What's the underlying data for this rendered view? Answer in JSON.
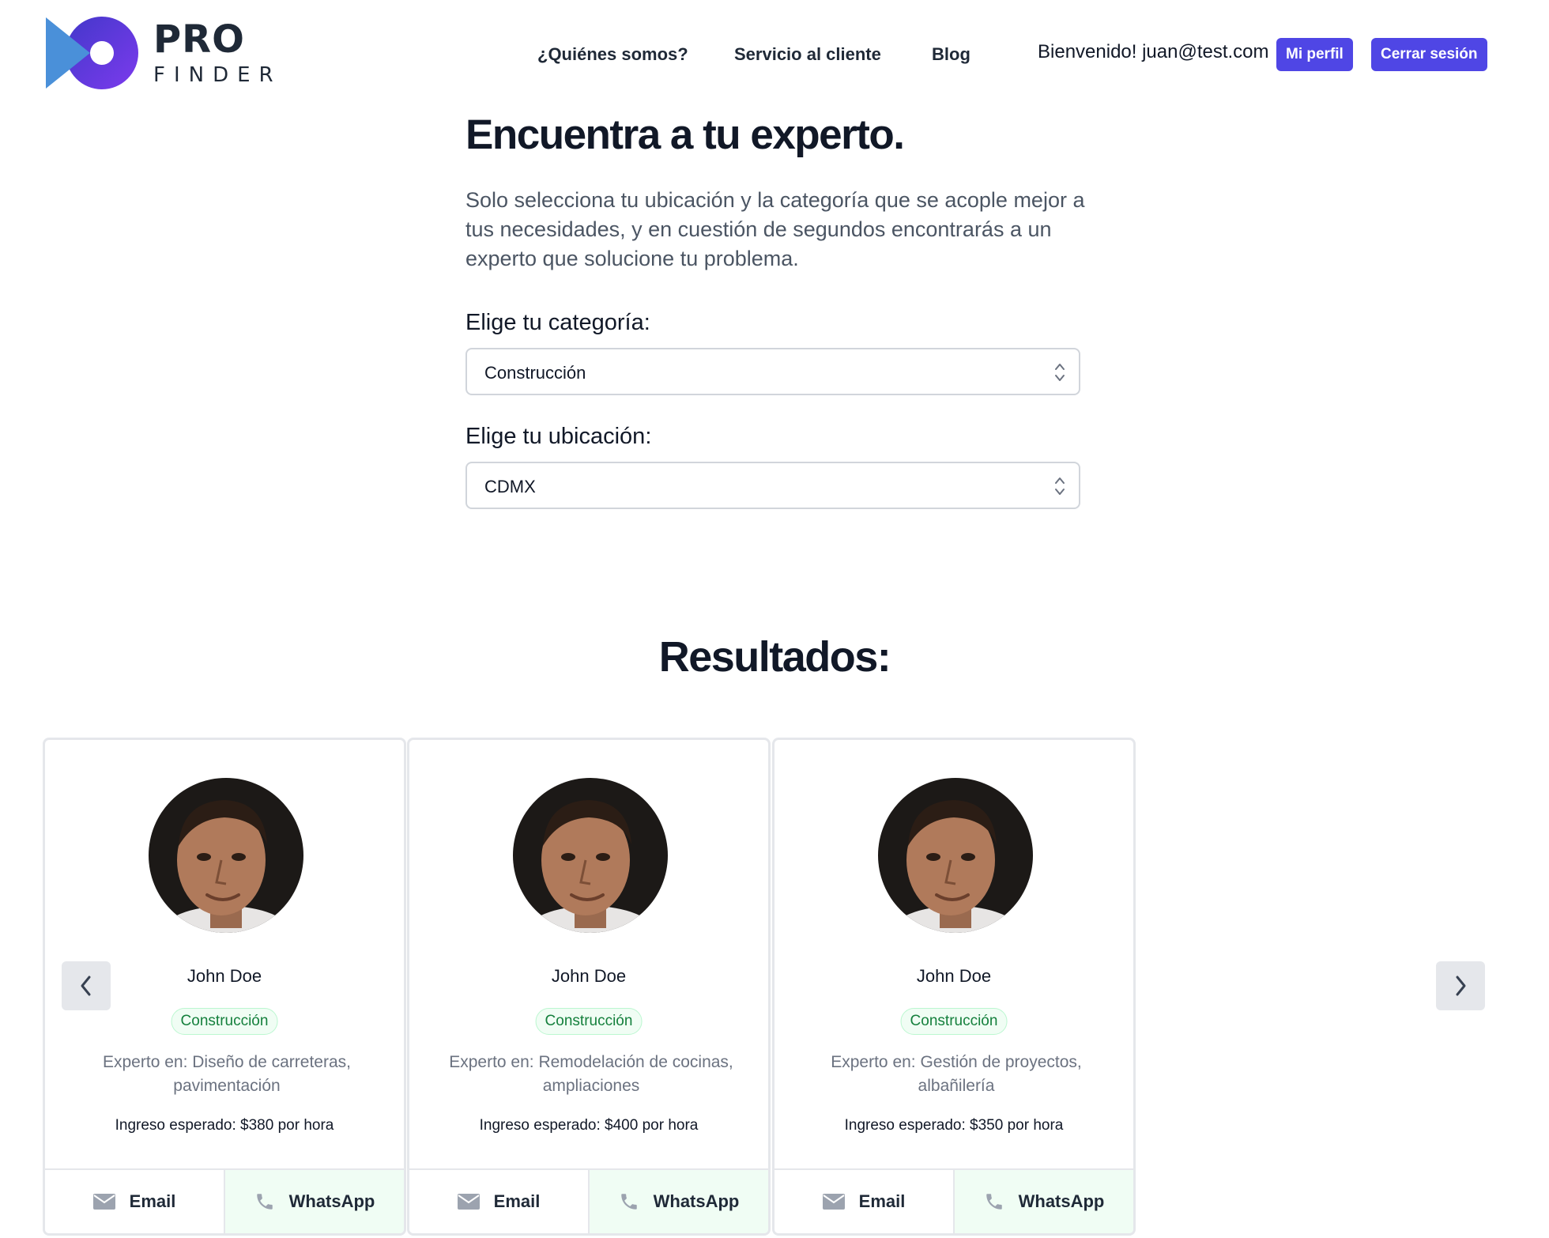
{
  "brand": {
    "line1": "PRO",
    "line2": "FINDER",
    "colors": {
      "accent": "#4f46e5",
      "blue": "#4a90d9",
      "purple": "#6d28d9"
    }
  },
  "nav": {
    "links": [
      "¿Quiénes somos?",
      "Servicio al cliente",
      "Blog"
    ],
    "welcome": "Bienvenido! juan@test.com",
    "profile_button": "Mi perfil",
    "logout_button": "Cerrar sesión"
  },
  "hero": {
    "title": "Encuentra a tu experto.",
    "description": "Solo selecciona tu ubicación y la categoría que se acople mejor a tus necesidades, y en cuestión de segundos encontrarás a un experto que solucione tu problema."
  },
  "filters": {
    "category": {
      "label": "Elige tu categoría:",
      "selected": "Construcción"
    },
    "location": {
      "label": "Elige tu ubicación:",
      "selected": "CDMX"
    }
  },
  "results": {
    "title": "Resultados:",
    "cards": [
      {
        "name": "John Doe",
        "category": "Construcción",
        "description": "Experto en: Diseño de carreteras, pavimentación",
        "income": "Ingreso esperado: $380 por hora",
        "email_label": "Email",
        "whatsapp_label": "WhatsApp"
      },
      {
        "name": "John Doe",
        "category": "Construcción",
        "description": "Experto en: Remodelación de cocinas, ampliaciones",
        "income": "Ingreso esperado: $400 por hora",
        "email_label": "Email",
        "whatsapp_label": "WhatsApp"
      },
      {
        "name": "John Doe",
        "category": "Construcción",
        "description": "Experto en: Gestión de proyectos, albañilería",
        "income": "Ingreso esperado: $350 por hora",
        "email_label": "Email",
        "whatsapp_label": "WhatsApp"
      }
    ],
    "prev_icon": "chevron-left-icon",
    "next_icon": "chevron-right-icon"
  }
}
